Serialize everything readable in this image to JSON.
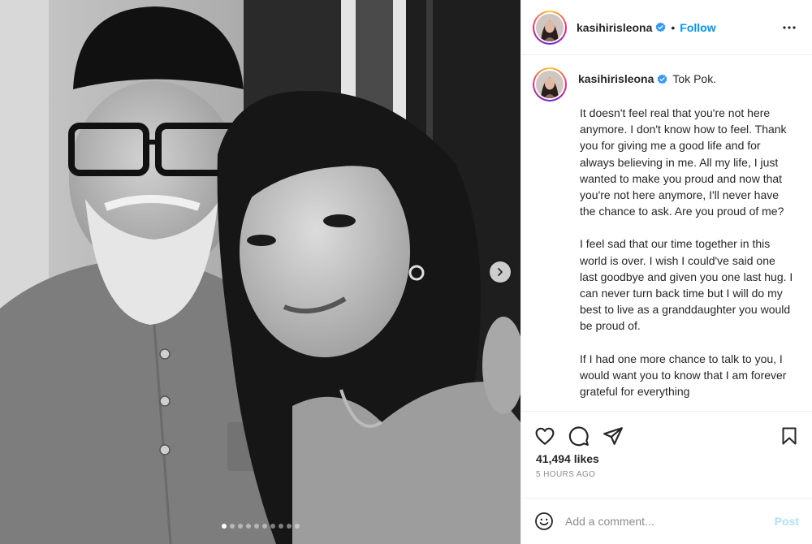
{
  "post": {
    "username": "kasihirisleona",
    "verified": true,
    "follow_label": "Follow",
    "separator": "•",
    "caption_title": "Tok Pok.",
    "caption_paragraphs": [
      "It doesn't feel real that you're not here anymore. I don't know how to feel. Thank you for giving me a good life and for always believing in me. All my life, I just wanted to make you proud and now that you're not here anymore, I'll never have the chance to ask. Are you proud of me?",
      "I feel sad that our time together in this world is over. I wish I could've said one last goodbye and given you one last hug. I can never turn back time but I will do my best to live as a granddaughter you would be proud of.",
      "If I had one more chance to talk to you, I would want you to know that I am forever grateful for everything"
    ],
    "likes": "41,494 likes",
    "time_ago": "5 HOURS AGO"
  },
  "carousel": {
    "slide_count": 10,
    "active_index": 0
  },
  "comment": {
    "placeholder": "Add a comment...",
    "post_label": "Post"
  },
  "icons": {
    "verified": "verified-badge-icon",
    "more": "more-options-icon",
    "like": "heart-icon",
    "comment": "comment-bubble-icon",
    "share": "paper-plane-icon",
    "save": "bookmark-icon",
    "emoji": "emoji-smile-icon",
    "next": "chevron-right-icon"
  },
  "colors": {
    "link_blue": "#0095f6",
    "post_disabled": "#b2dffc",
    "verified_blue": "#3897f0",
    "muted_text": "#8e8e8e",
    "border": "#efefef"
  }
}
